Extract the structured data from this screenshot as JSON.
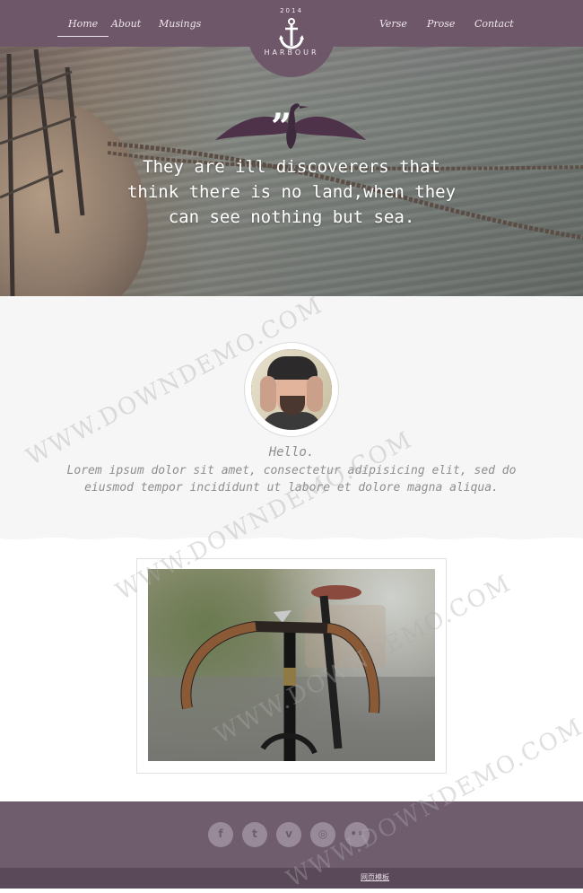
{
  "nav": {
    "left": [
      "Home",
      "About",
      "Musings"
    ],
    "right": [
      "Verse",
      "Prose",
      "Contact"
    ],
    "active": "Home"
  },
  "brand": {
    "year": "2014",
    "name": "HARBOUR",
    "icon": "anchor-icon"
  },
  "hero": {
    "quote_mark": "”",
    "quote": "They are ill discoverers that think there is no land,when they can see nothing but sea."
  },
  "about": {
    "hello": "Hello.",
    "text": "Lorem ipsum dolor sit amet, consectetur adipisicing elit, sed do eiusmod tempor incididunt ut labore et dolore magna aliqua."
  },
  "footer": {
    "social": [
      {
        "name": "facebook-icon",
        "glyph": "f"
      },
      {
        "name": "twitter-icon",
        "glyph": "t"
      },
      {
        "name": "vimeo-icon",
        "glyph": "v"
      },
      {
        "name": "dribbble-icon",
        "glyph": "◎"
      },
      {
        "name": "flickr-icon",
        "glyph": "••"
      }
    ],
    "link_cn": "网页模板"
  },
  "watermark": "WWW.DOWNDEMO.COM",
  "colors": {
    "brand": "#6d5768",
    "footer": "#6f5d6e",
    "footbar": "#5a4a59",
    "about_bg": "#f6f6f6"
  }
}
